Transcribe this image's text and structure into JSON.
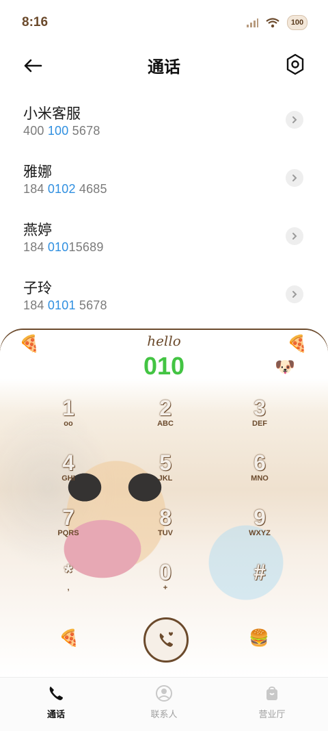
{
  "status": {
    "time": "8:16",
    "battery": "100"
  },
  "header": {
    "title": "通话"
  },
  "contacts": [
    {
      "name": "小米客服",
      "num_pre": "400 ",
      "num_hl": "100",
      "num_post": " 5678"
    },
    {
      "name": "雅娜",
      "num_pre": "184 ",
      "num_hl": "0102",
      "num_post": " 4685"
    },
    {
      "name": "燕婷",
      "num_pre": "184 ",
      "num_hl": "010",
      "num_post": "15689"
    },
    {
      "name": "子玲",
      "num_pre": "184 ",
      "num_hl": "0101",
      "num_post": " 5678"
    }
  ],
  "dialer": {
    "hello": "hello",
    "typed_number": "010",
    "keys": [
      {
        "digit": "1",
        "letters": "oo"
      },
      {
        "digit": "2",
        "letters": "ABC"
      },
      {
        "digit": "3",
        "letters": "DEF"
      },
      {
        "digit": "4",
        "letters": "GHI"
      },
      {
        "digit": "5",
        "letters": "JKL"
      },
      {
        "digit": "6",
        "letters": "MNO"
      },
      {
        "digit": "7",
        "letters": "PQRS"
      },
      {
        "digit": "8",
        "letters": "TUV"
      },
      {
        "digit": "9",
        "letters": "WXYZ"
      },
      {
        "digit": "*",
        "letters": ","
      },
      {
        "digit": "0",
        "letters": "+"
      },
      {
        "digit": "#",
        "letters": ""
      }
    ],
    "stickers": {
      "left_top": "pizza-thought",
      "right_top": "pizza-thought",
      "dog": "dog-face",
      "left_bottom": "pizza",
      "right_bottom": "burger"
    }
  },
  "tabs": [
    {
      "label": "通话",
      "active": true
    },
    {
      "label": "联系人",
      "active": false
    },
    {
      "label": "营业厅",
      "active": false
    }
  ],
  "colors": {
    "accent_brown": "#6b4a2c",
    "highlight_blue": "#2f8fe0",
    "typed_green": "#43c443"
  }
}
